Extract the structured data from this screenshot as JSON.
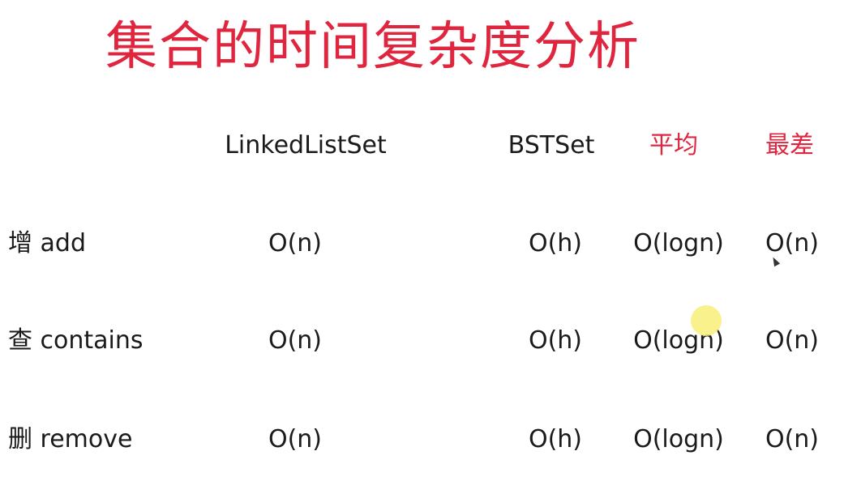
{
  "title": "集合的时间复杂度分析",
  "headers": {
    "linkedlist": "LinkedListSet",
    "bst": "BSTSet",
    "average": "平均",
    "worst": "最差"
  },
  "rows": [
    {
      "label": "增 add",
      "linkedlist": "O(n)",
      "bst": "O(h)",
      "average": "O(logn)",
      "worst": "O(n)"
    },
    {
      "label": "查 contains",
      "linkedlist": "O(n)",
      "bst": "O(h)",
      "average": "O(logn)",
      "worst": "O(n)"
    },
    {
      "label": "删 remove",
      "linkedlist": "O(n)",
      "bst": "O(h)",
      "average": "O(logn)",
      "worst": "O(n)"
    }
  ],
  "colors": {
    "accent": "#e0263f",
    "text": "#1a1a1a",
    "highlight": "#f8ee78"
  }
}
